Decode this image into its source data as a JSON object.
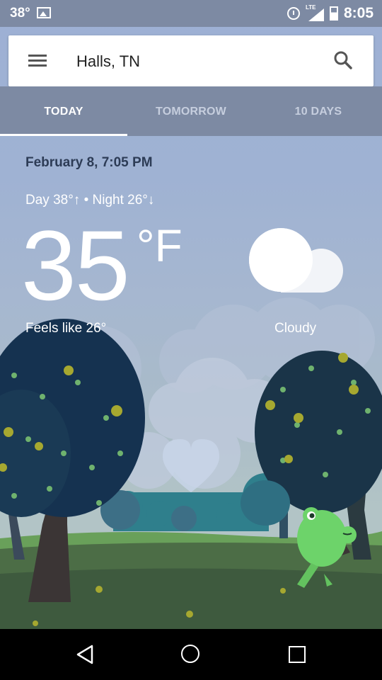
{
  "status_bar": {
    "temperature": "38°",
    "time": "8:05",
    "network": "LTE",
    "icons": [
      "image-icon",
      "alarm-icon",
      "lte-signal-icon",
      "battery-charging-icon"
    ]
  },
  "search": {
    "location": "Halls, TN",
    "menu_icon": "menu-icon",
    "search_icon": "search-icon"
  },
  "tabs": [
    {
      "label": "TODAY",
      "active": true
    },
    {
      "label": "TOMORROW",
      "active": false
    },
    {
      "label": "10 DAYS",
      "active": false
    }
  ],
  "weather": {
    "date": "February 8, 7:05 PM",
    "day_night": "Day 38°↑ • Night 26°↓",
    "temperature": "35",
    "unit": "°F",
    "feels_like": "Feels like 26°",
    "condition": "Cloudy",
    "condition_icon": "cloud-icon"
  },
  "nav_bar": {
    "icons": [
      "back-icon",
      "home-icon",
      "recents-icon"
    ]
  },
  "colors": {
    "status_bar": "#7d8aa3",
    "tab_bar": "#7d8aa3",
    "sky": "#9db0d4",
    "date_text": "#2d3c56",
    "tree_dark": "#14314b",
    "grass": "#4c6d46",
    "frog": "#6dd36a"
  }
}
